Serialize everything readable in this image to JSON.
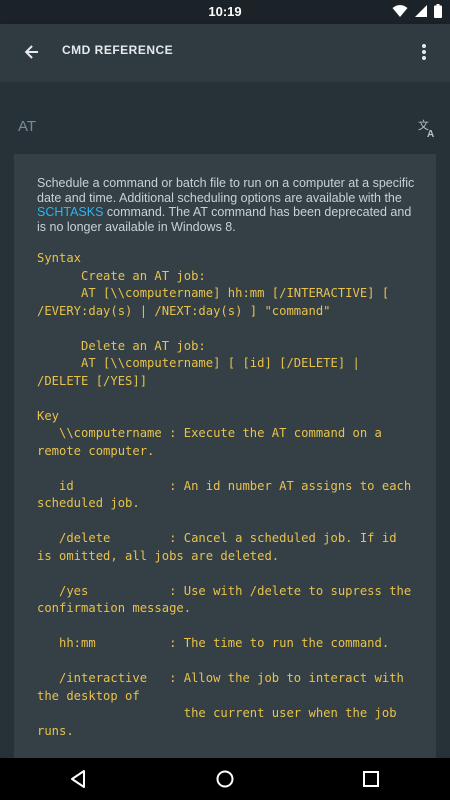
{
  "status_bar": {
    "time": "10:19"
  },
  "app_bar": {
    "title": "CMD REFERENCE"
  },
  "command": {
    "name": "AT"
  },
  "description": {
    "text_before": "Schedule a command or batch file to run on a computer at a specific date and time. Additional scheduling options are available with the ",
    "link": "SCHTASKS",
    "text_after": " command. The AT command has been deprecated and is no longer available in Windows 8."
  },
  "syntax_block": "Syntax\n      Create an AT job:\n      AT [\\\\computername] hh:mm [/INTERACTIVE] [\n/EVERY:day(s) | /NEXT:day(s) ] \"command\"\n\n      Delete an AT job:\n      AT [\\\\computername] [ [id] [/DELETE] |\n/DELETE [/YES]]\n\nKey\n   \\\\computername : Execute the AT command on a\nremote computer.\n\n   id             : An id number AT assigns to each\nscheduled job.\n\n   /delete        : Cancel a scheduled job. If id\nis omitted, all jobs are deleted.\n\n   /yes           : Use with /delete to supress the\nconfirmation message.\n\n   hh:mm          : The time to run the command.\n\n   /interactive   : Allow the job to interact with\nthe desktop of\n                    the current user when the job\nruns.",
  "icons": {
    "wifi": "wifi-icon",
    "signal": "signal-icon",
    "battery": "battery-icon",
    "back": "arrow-back-icon",
    "overflow": "more-vert-icon",
    "translate": "translate-icon",
    "nav_back": "nav-back-icon",
    "nav_home": "nav-home-icon",
    "nav_recents": "nav-recents-icon"
  },
  "colors": {
    "background": "#263238",
    "app_bar": "#2f3a41",
    "card": "#343f46",
    "code_text": "#e8c24a",
    "link": "#29b6f6"
  }
}
